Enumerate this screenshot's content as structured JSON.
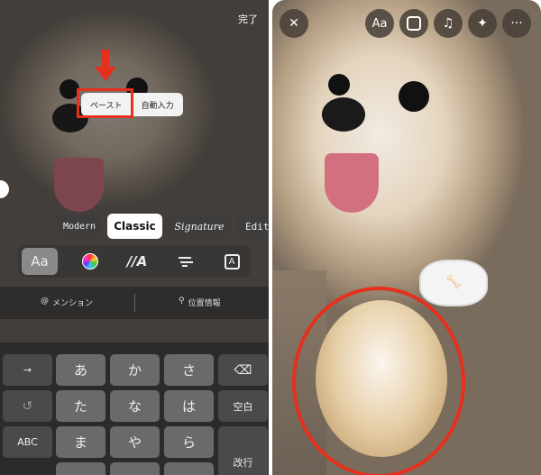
{
  "left": {
    "done_label": "完了",
    "context_menu": {
      "paste": "ペースト",
      "autofill": "自動入力"
    },
    "font_styles": [
      "Modern",
      "Classic",
      "Signature",
      "Edit"
    ],
    "selected_font": "Classic",
    "toolbar": {
      "font_label": "Aa",
      "animation_label": "//A",
      "background_label": "A"
    },
    "mention_label": "メンション",
    "location_label": "位置情報",
    "keyboard": {
      "rows": [
        [
          "→",
          "あ",
          "か",
          "さ",
          "⌫"
        ],
        [
          "↺",
          "た",
          "な",
          "は",
          "空白"
        ],
        [
          "ABC",
          "ま",
          "や",
          "ら",
          "改行"
        ]
      ]
    }
  },
  "right": {
    "buttons": {
      "close": "✕",
      "text": "Aa",
      "more": "···"
    }
  },
  "colors": {
    "highlight": "#e5301e"
  }
}
